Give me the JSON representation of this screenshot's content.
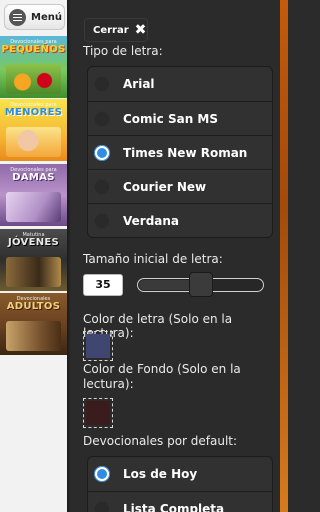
{
  "drawer": {
    "menu_label": "Menú",
    "thumbnails": [
      {
        "id": "th1",
        "small": "Devocionales para",
        "big": "PEQUEÑOS"
      },
      {
        "id": "th2",
        "small": "Devocionales para",
        "big": "MENORES"
      },
      {
        "id": "th3",
        "small": "Devocionales para",
        "big": "DAMAS"
      },
      {
        "id": "th4",
        "small": "Matutina",
        "big": "JÓVENES"
      },
      {
        "id": "th5",
        "small": "Devocionales",
        "big": "ADULTOS"
      }
    ]
  },
  "panel": {
    "close_label": "Cerrar",
    "font_section_label": "Tipo de letra:",
    "fonts": [
      {
        "label": "Arial",
        "selected": false
      },
      {
        "label": "Comic San MS",
        "selected": false
      },
      {
        "label": "Times New Roman",
        "selected": true
      },
      {
        "label": "Courier New",
        "selected": false
      },
      {
        "label": "Verdana",
        "selected": false
      }
    ],
    "size_section_label": "Tamaño inicial de letra:",
    "font_size_value": "35",
    "font_size_slider_fraction": 0.5,
    "text_color_label": "Color de letra (Solo en la lectura):",
    "text_color": "#3f4670",
    "bg_color_label": "Color de Fondo (Solo en la lectura):",
    "bg_color": "#3a1c1c",
    "default_section_label": "Devocionales por default:",
    "defaults": [
      {
        "label": "Los de Hoy",
        "selected": true
      },
      {
        "label": "Lista Completa",
        "selected": false
      }
    ]
  },
  "colors": {
    "accent_radio": "#2f8ee3",
    "edge_orange": "#c55a0b"
  }
}
